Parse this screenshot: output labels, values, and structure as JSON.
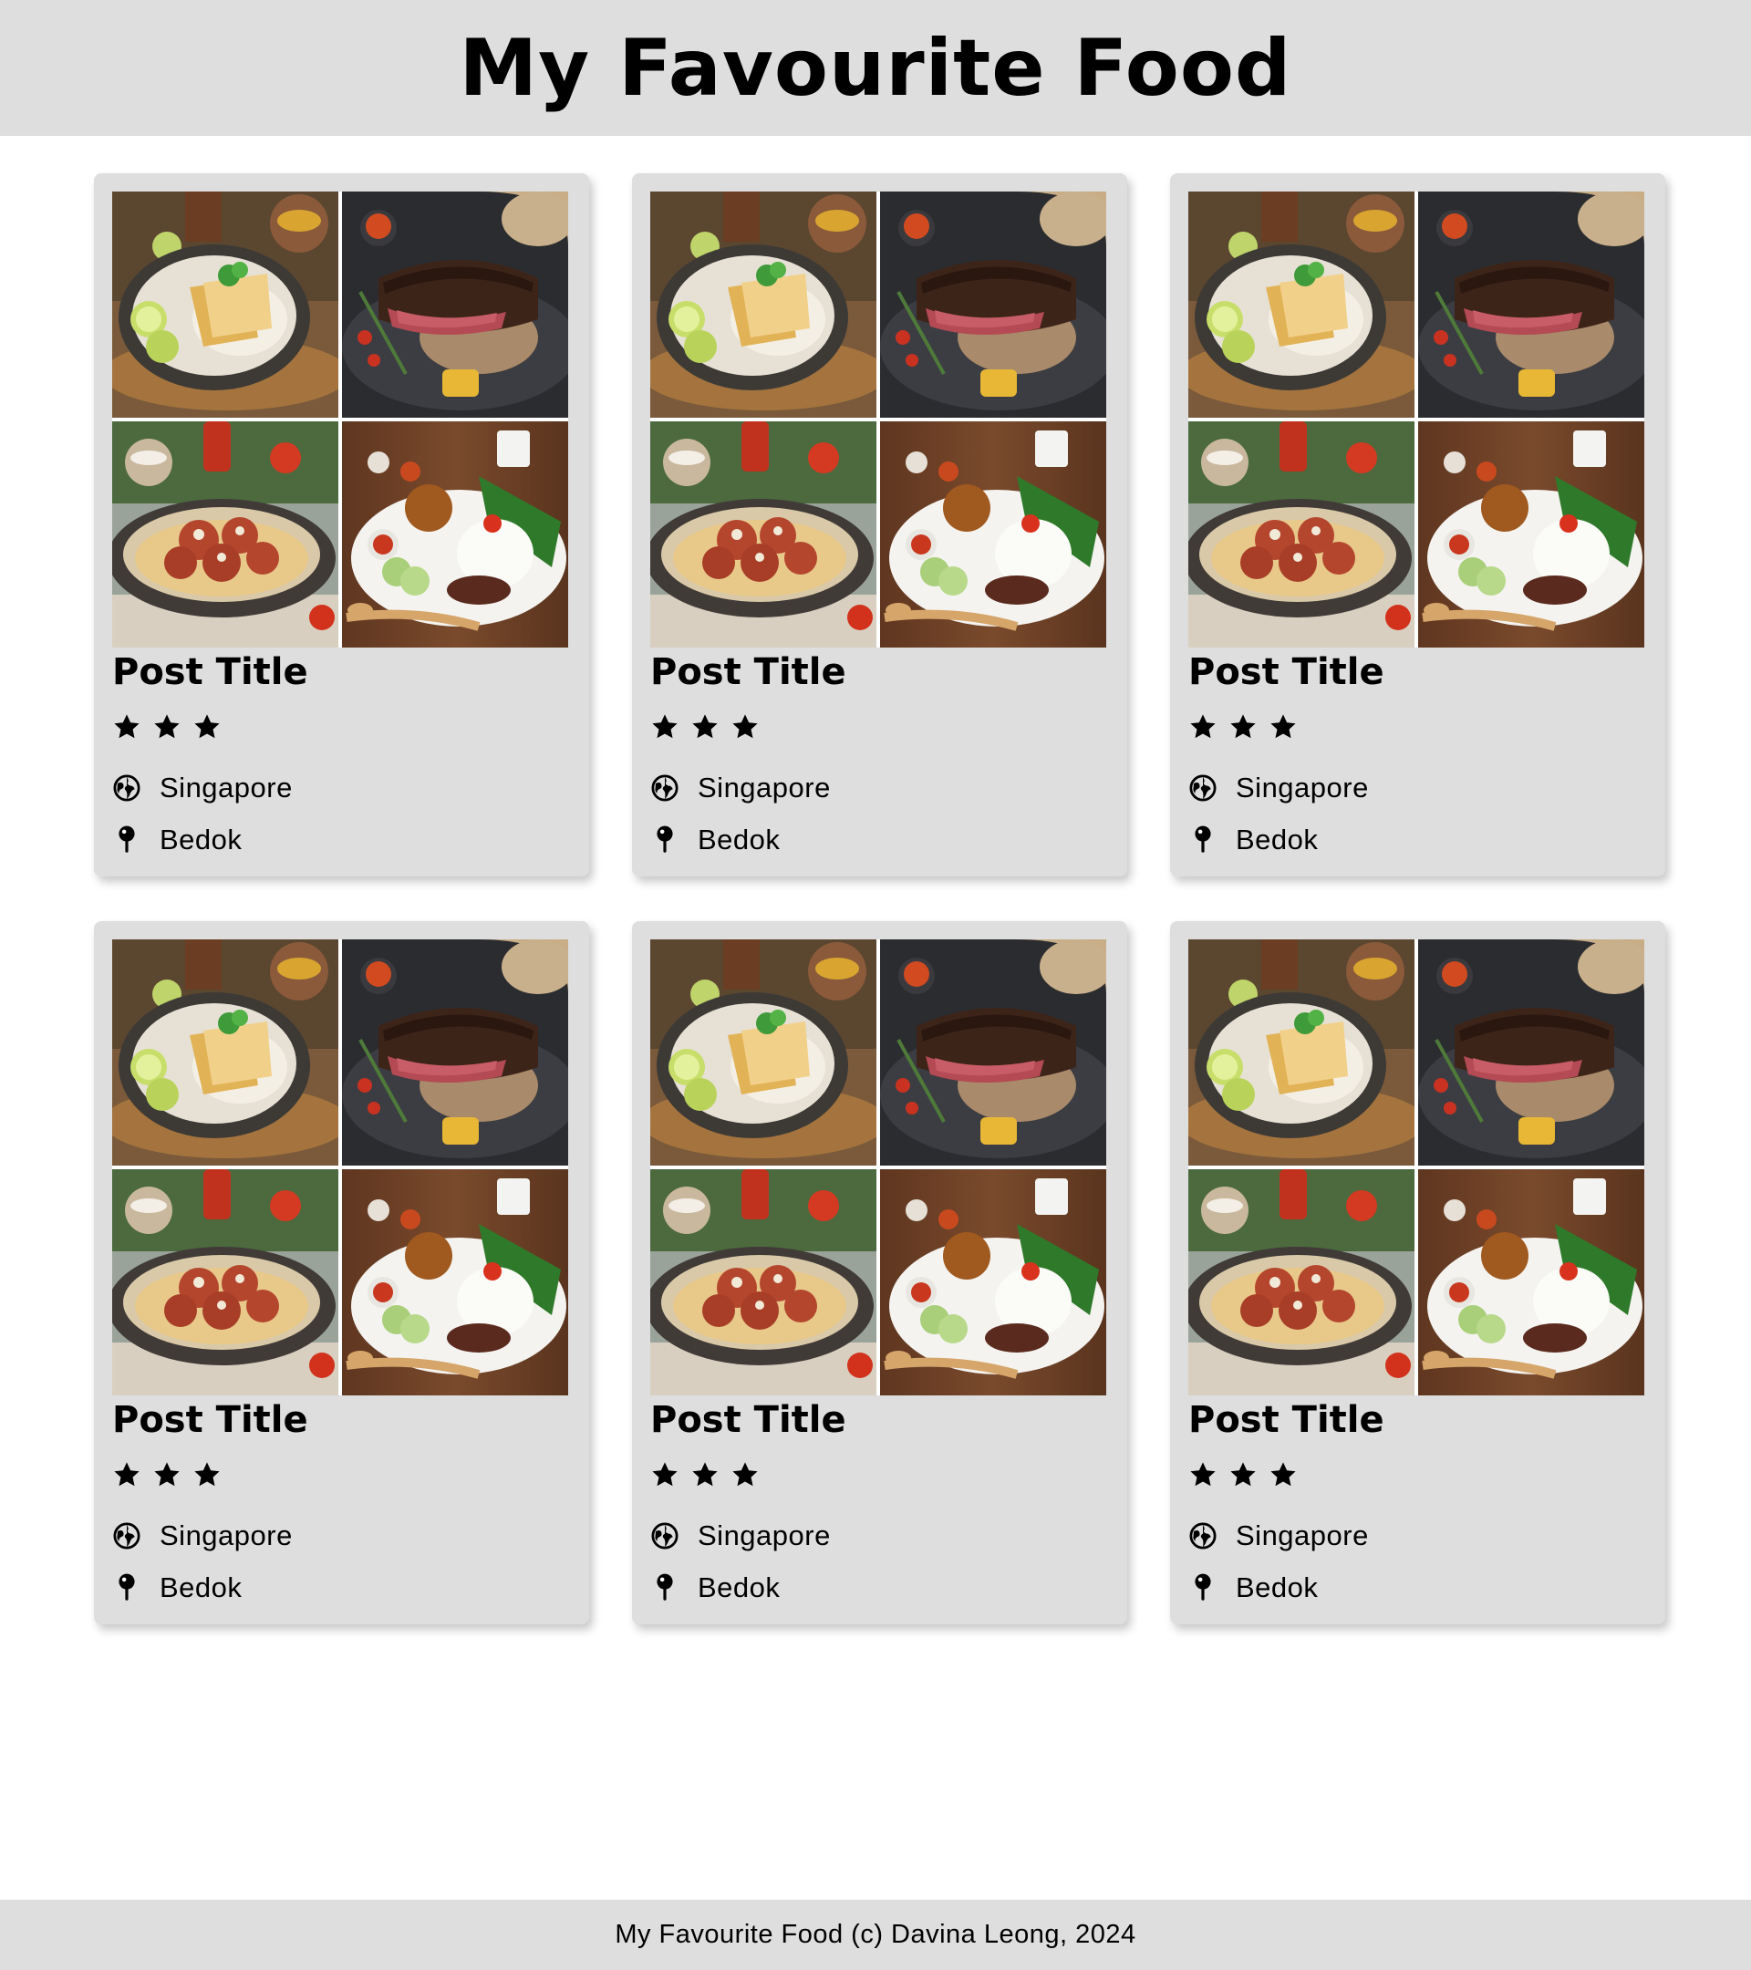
{
  "header": {
    "title": "My Favourite Food"
  },
  "posts": [
    {
      "title": "Post Title",
      "rating": 3,
      "country": "Singapore",
      "area": "Bedok",
      "photo_icons": [
        "chicken-rice-photo",
        "steak-photo",
        "spaghetti-meatballs-photo",
        "nasi-lemak-photo"
      ]
    },
    {
      "title": "Post Title",
      "rating": 3,
      "country": "Singapore",
      "area": "Bedok",
      "photo_icons": [
        "chicken-rice-photo",
        "steak-photo",
        "spaghetti-meatballs-photo",
        "nasi-lemak-photo"
      ]
    },
    {
      "title": "Post Title",
      "rating": 3,
      "country": "Singapore",
      "area": "Bedok",
      "photo_icons": [
        "chicken-rice-photo",
        "steak-photo",
        "spaghetti-meatballs-photo",
        "nasi-lemak-photo"
      ]
    },
    {
      "title": "Post Title",
      "rating": 3,
      "country": "Singapore",
      "area": "Bedok",
      "photo_icons": [
        "chicken-rice-photo",
        "steak-photo",
        "spaghetti-meatballs-photo",
        "nasi-lemak-photo"
      ]
    },
    {
      "title": "Post Title",
      "rating": 3,
      "country": "Singapore",
      "area": "Bedok",
      "photo_icons": [
        "chicken-rice-photo",
        "steak-photo",
        "spaghetti-meatballs-photo",
        "nasi-lemak-photo"
      ]
    },
    {
      "title": "Post Title",
      "rating": 3,
      "country": "Singapore",
      "area": "Bedok",
      "photo_icons": [
        "chicken-rice-photo",
        "steak-photo",
        "spaghetti-meatballs-photo",
        "nasi-lemak-photo"
      ]
    }
  ],
  "icons": {
    "star": "star-icon",
    "country": "globe-icon",
    "area": "map-pin-icon"
  },
  "colors": {
    "header_bg": "#dedede",
    "card_bg": "#dedede",
    "footer_bg": "#dedede"
  },
  "footer": {
    "text": "My Favourite Food (c) Davina Leong, 2024"
  }
}
